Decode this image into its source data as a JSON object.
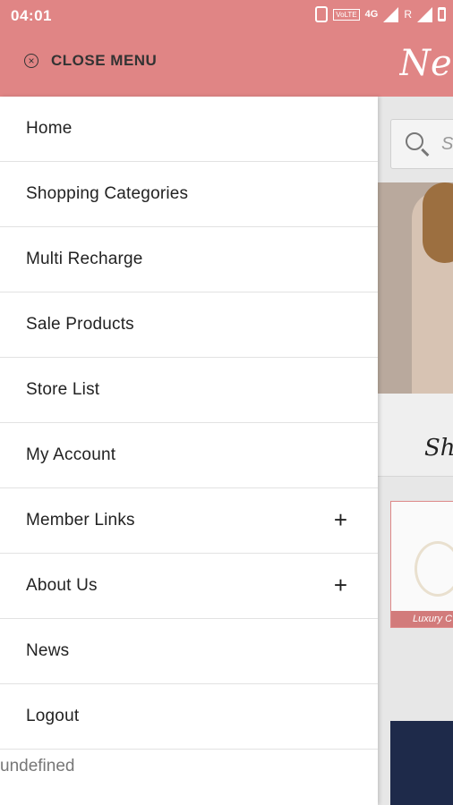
{
  "status_bar": {
    "time": "04:01",
    "icons": [
      "vibrate-icon",
      "volte-icon",
      "4g-icon",
      "signal-icon",
      "roaming-icon",
      "signal-x-icon",
      "battery-icon"
    ],
    "volte_text": "VoLTE",
    "network_text": "4G",
    "roaming_text": "R"
  },
  "header": {
    "close_label": "CLOSE MENU",
    "close_icon": "close-circle-icon",
    "logo_text": "Netp",
    "accent_color": "#e08585"
  },
  "menu": {
    "items": [
      {
        "label": "Home",
        "expandable": false
      },
      {
        "label": "Shopping Categories",
        "expandable": false
      },
      {
        "label": "Multi Recharge",
        "expandable": false
      },
      {
        "label": "Sale Products",
        "expandable": false
      },
      {
        "label": "Store List",
        "expandable": false
      },
      {
        "label": "My Account",
        "expandable": false
      },
      {
        "label": "Member Links",
        "expandable": true,
        "expand_symbol": "+"
      },
      {
        "label": "About Us",
        "expandable": true,
        "expand_symbol": "+"
      },
      {
        "label": "News",
        "expandable": false
      },
      {
        "label": "Logout",
        "expandable": false
      }
    ],
    "footer_text": "undefined"
  },
  "background_page": {
    "search_placeholder": "S",
    "section_title": "Sho",
    "product_tag": "Luxury C"
  }
}
